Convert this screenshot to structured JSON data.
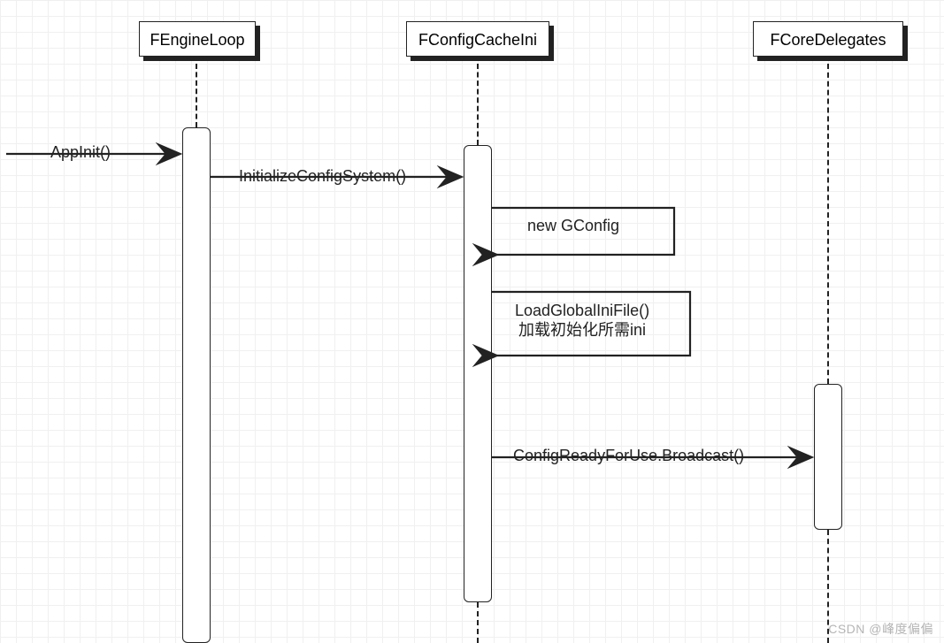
{
  "lifelines": {
    "l1": "FEngineLoop",
    "l2": "FConfigCacheIni",
    "l3": "FCoreDelegates"
  },
  "messages": {
    "m1": "AppInit()",
    "m2": "InitializeConfigSystem()",
    "m3": "new GConfig",
    "m4_line1": "LoadGlobalIniFile()",
    "m4_line2": "加载初始化所需ini",
    "m5": "ConfigReadyForUse.Broadcast()"
  },
  "watermark": "CSDN @峰度偏偏"
}
